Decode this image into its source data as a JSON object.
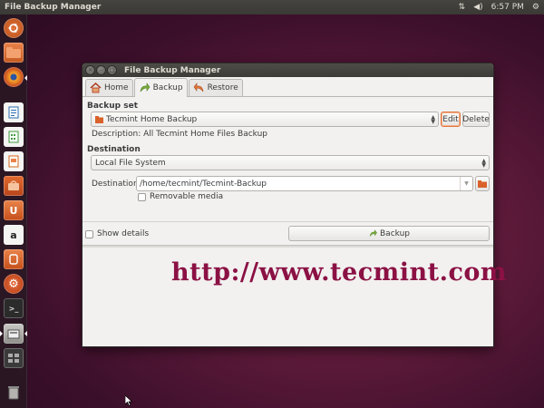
{
  "top_panel": {
    "app_title": "File Backup Manager",
    "clock": "6:57 PM"
  },
  "launcher": {
    "icons": [
      "dash-home-icon",
      "files-icon",
      "firefox-icon",
      "writer-icon",
      "calc-icon",
      "impress-icon",
      "software-center-icon",
      "ubuntu-one-icon",
      "amazon-icon",
      "ubuntu-one-music-icon",
      "system-settings-icon",
      "terminal-icon",
      "file-backup-icon",
      "workspace-switcher-icon",
      "trash-icon"
    ],
    "amazon_glyph": "a",
    "ubuntu_one_glyph": "U"
  },
  "window": {
    "title": "File Backup Manager",
    "tabs": [
      {
        "label": "Home",
        "active": false
      },
      {
        "label": "Backup",
        "active": true
      },
      {
        "label": "Restore",
        "active": false
      }
    ],
    "backup_set": {
      "section_label": "Backup set",
      "selected": "Tecmint Home Backup",
      "edit_label": "Edit",
      "delete_label": "Delete",
      "description": "Description: All Tecmint Home Files Backup"
    },
    "destination": {
      "section_label": "Destination",
      "type_selected": "Local File System",
      "field_label": "Destination:",
      "path": "/home/tecmint/Tecmint-Backup",
      "removable_label": "Removable media",
      "removable_checked": false
    },
    "show_details_label": "Show details",
    "show_details_checked": false,
    "backup_button_label": "Backup"
  },
  "watermark": "http://www.tecmint.com",
  "colors": {
    "accent_orange": "#e2763d",
    "watermark": "#8b1144",
    "backup_arrow_green": "#7cae3e"
  }
}
